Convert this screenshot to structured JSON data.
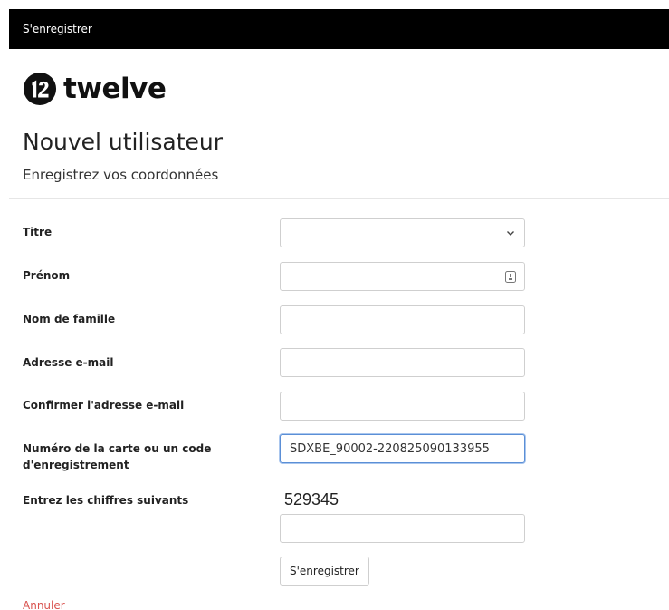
{
  "topbar": {
    "title": "S'enregistrer"
  },
  "logo": {
    "text": "twelve"
  },
  "header": {
    "title": "Nouvel utilisateur",
    "subtitle": "Enregistrez vos coordonnées"
  },
  "form": {
    "title_label": "Titre",
    "title_value": "",
    "firstname_label": "Prénom",
    "firstname_value": "",
    "lastname_label": "Nom de famille",
    "lastname_value": "",
    "email_label": "Adresse e-mail",
    "email_value": "",
    "email_confirm_label": "Confirmer l'adresse e-mail",
    "email_confirm_value": "",
    "card_label": "Numéro de la carte ou un code d'enregistrement",
    "card_value": "SDXBE_90002-220825090133955",
    "captcha_label": "Entrez les chiffres suivants",
    "captcha_code": "529345",
    "captcha_value": "",
    "submit_label": "S'enregistrer",
    "cancel_label": "Annuler"
  },
  "colors": {
    "topbar_bg": "#000000",
    "cancel_link": "#d9534f",
    "focus_border": "#5b8fd6"
  },
  "icons": [
    "logo-mark-icon",
    "chevron-down-icon",
    "password-key-icon"
  ]
}
